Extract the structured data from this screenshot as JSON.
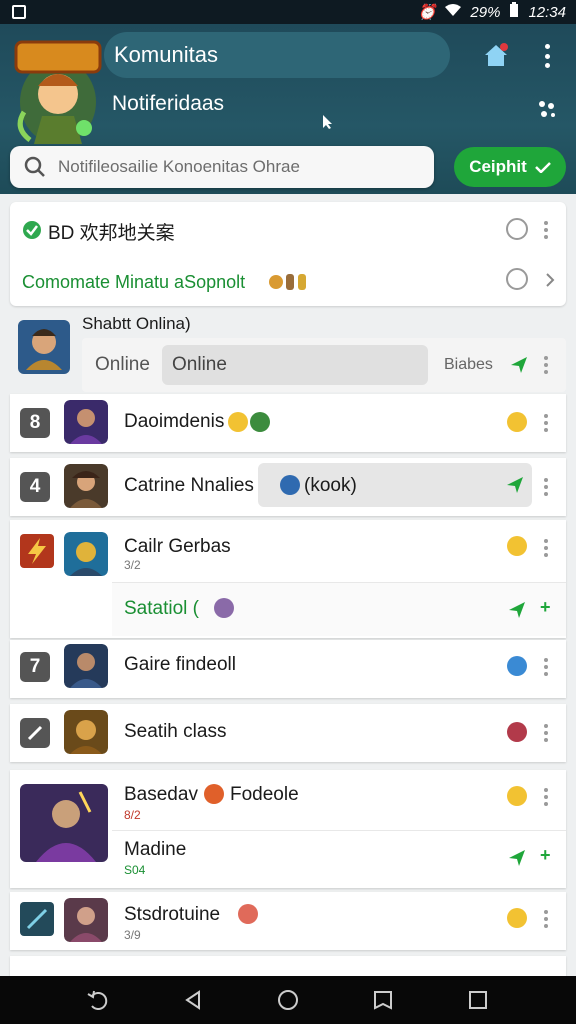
{
  "status": {
    "battery": "29%",
    "time": "12:34"
  },
  "header": {
    "title": "Komunitas",
    "subtitle": "Notiferidaas"
  },
  "search": {
    "placeholder": "Notifileosailie Konoenitas Ohrae"
  },
  "go_button": {
    "label": "Ceiphit"
  },
  "top_card": {
    "row1": "BD 欢邦地关案",
    "row2": "Comomate Minatu aSopnolt"
  },
  "online": {
    "heading": "Shabtt Onlina)",
    "label": "Online",
    "field_value": "Online",
    "right_label": "Biabes"
  },
  "list": [
    {
      "badge": "8",
      "title": "Daoimdenis"
    },
    {
      "badge": "4",
      "title": "Catrine Nnalies",
      "extra": "(kook)"
    },
    {
      "title": "Cailr Gerbas",
      "sub": "3/2"
    },
    {
      "title": "Satatiol (",
      "highlight": true
    },
    {
      "badge": "7",
      "title": "Gaire findeoll"
    },
    {
      "title": "Seatih class"
    },
    {
      "title": "Basedav",
      "extra": "Fodeole",
      "sub": "8/2"
    },
    {
      "title": "Madine",
      "sub": "S04"
    },
    {
      "title": "Stsdrotuine",
      "sub": "3/9"
    }
  ],
  "colors": {
    "accent": "#1fa63a",
    "header": "#255766"
  }
}
